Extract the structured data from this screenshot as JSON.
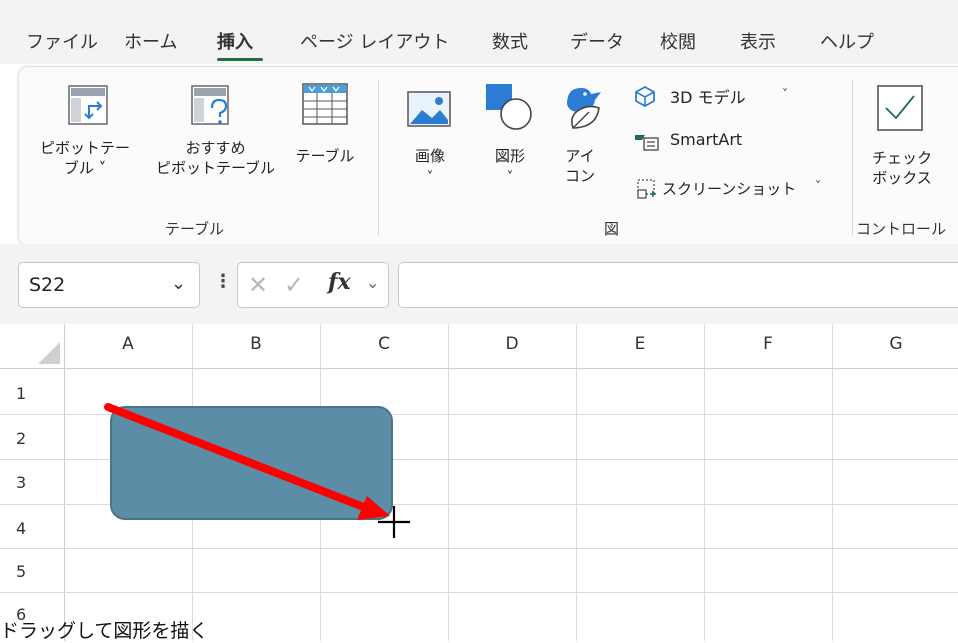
{
  "menu": {
    "tabs": [
      "ファイル",
      "ホーム",
      "挿入",
      "ページ レイアウト",
      "数式",
      "データ",
      "校閲",
      "表示",
      "ヘルプ"
    ],
    "active_tab": "挿入"
  },
  "ribbon": {
    "pivot_table": {
      "line1": "ピボットテー",
      "line2": "ブル ˅"
    },
    "recommended": {
      "line1": "おすすめ",
      "line2": "ピボットテーブル"
    },
    "table": {
      "label": "テーブル"
    },
    "group_table": "テーブル",
    "images": {
      "label": "画像",
      "chev": "˅"
    },
    "shapes": {
      "label": "図形",
      "chev": "˅"
    },
    "icons": {
      "line1": "アイ",
      "line2": "コン"
    },
    "model3d": "3D モデル",
    "smartart": "SmartArt",
    "screenshot": "スクリーンショット",
    "group_figure": "図",
    "checkbox": {
      "line1": "チェック",
      "line2": "ボックス"
    },
    "group_control": "コントロール",
    "accent_color": "#1e7145"
  },
  "formula_bar": {
    "name_box": "S22",
    "fx_label": "fx",
    "formula": ""
  },
  "sheet": {
    "columns": [
      "A",
      "B",
      "C",
      "D",
      "E",
      "F",
      "G"
    ],
    "rows": [
      "1",
      "2",
      "3",
      "4",
      "5",
      "6"
    ],
    "shape_color": "#5b8ea6",
    "arrow_color": "#ff0000"
  },
  "caption": "ドラッグして図形を描く"
}
